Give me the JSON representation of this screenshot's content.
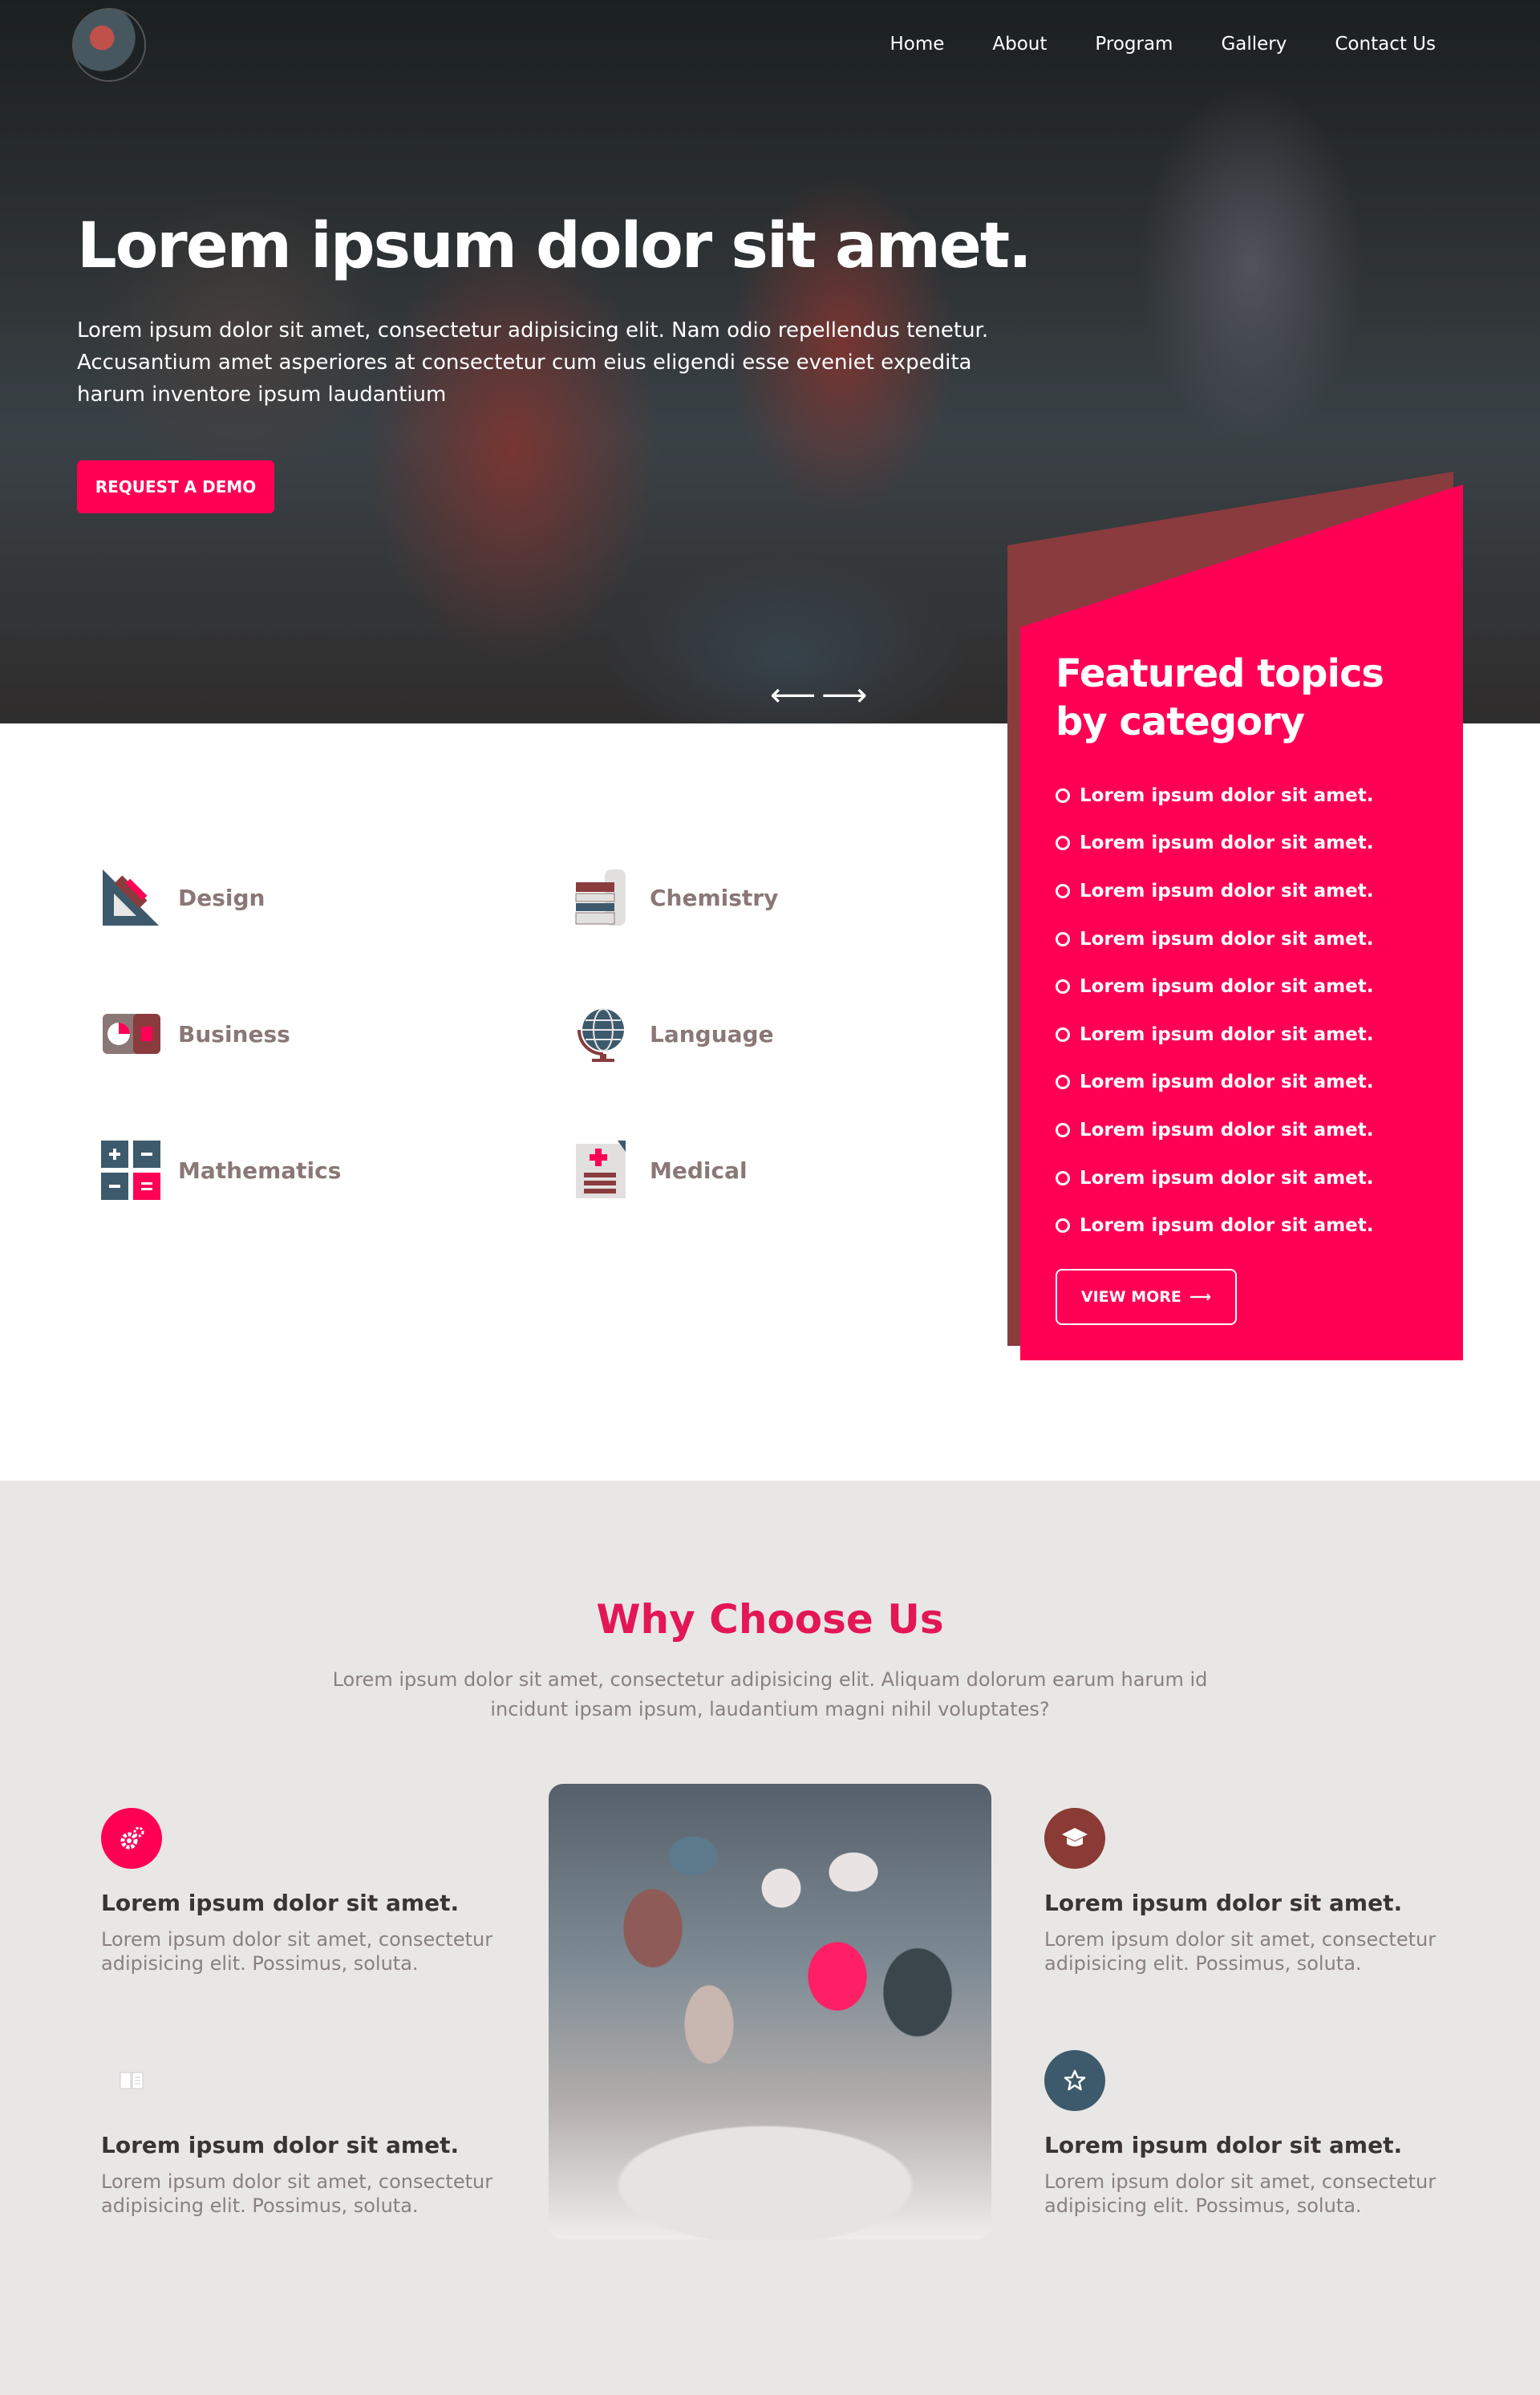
{
  "nav": {
    "items": [
      "Home",
      "About",
      "Program",
      "Gallery",
      "Contact Us"
    ]
  },
  "hero": {
    "title": "Lorem ipsum dolor sit amet.",
    "description": "Lorem ipsum dolor sit amet, consectetur adipisicing elit. Nam odio repellendus tenetur. Accusantium amet asperiores at consectetur cum eius eligendi esse eveniet expedita harum inventore ipsum laudantium",
    "cta_label": "REQUEST A DEMO",
    "prev_arrow": "⟵",
    "next_arrow": "⟶"
  },
  "featured": {
    "title": "Featured topics by category",
    "items": [
      "Lorem ipsum dolor sit amet.",
      "Lorem ipsum dolor sit amet.",
      "Lorem ipsum dolor sit amet.",
      "Lorem ipsum dolor sit amet.",
      "Lorem ipsum dolor sit amet.",
      "Lorem ipsum dolor sit amet.",
      "Lorem ipsum dolor sit amet.",
      "Lorem ipsum dolor sit amet.",
      "Lorem ipsum dolor sit amet.",
      "Lorem ipsum dolor sit amet."
    ],
    "button_label": "VIEW MORE",
    "button_arrow": "⟶"
  },
  "categories": [
    {
      "label": "Design",
      "icon": "design-icon"
    },
    {
      "label": "Chemistry",
      "icon": "chemistry-icon"
    },
    {
      "label": "Business",
      "icon": "business-icon"
    },
    {
      "label": "Language",
      "icon": "globe-icon"
    },
    {
      "label": "Mathematics",
      "icon": "mathematics-icon"
    },
    {
      "label": "Medical",
      "icon": "medical-icon"
    }
  ],
  "why": {
    "title": "Why Choose Us",
    "subtitle": "Lorem ipsum dolor sit amet, consectetur adipisicing elit. Aliquam dolorum earum harum id incidunt ipsam ipsum, laudantium magni nihil voluptates?",
    "features": [
      {
        "title": "Lorem ipsum dolor sit amet.",
        "text": "Lorem ipsum dolor sit amet, consectetur adipisicing elit. Possimus, soluta.",
        "icon": "gears-icon",
        "color": "#ff0055"
      },
      {
        "title": "Lorem ipsum dolor sit amet.",
        "text": "Lorem ipsum dolor sit amet, consectetur adipisicing elit. Possimus, soluta.",
        "icon": "graduation-cap-icon",
        "color": "#8a3b35"
      },
      {
        "title": "Lorem ipsum dolor sit amet.",
        "text": "Lorem ipsum dolor sit amet, consectetur adipisicing elit. Possimus, soluta.",
        "icon": "book-icon",
        "color": "#e8e7e6"
      },
      {
        "title": "Lorem ipsum dolor sit amet.",
        "text": "Lorem ipsum dolor sit amet, consectetur adipisicing elit. Possimus, soluta.",
        "icon": "star-icon",
        "color": "#3d5a6c"
      }
    ]
  },
  "colors": {
    "accent": "#ff0055",
    "accent_dark": "#8a3b3e",
    "title_red": "#e31755",
    "section_bg": "#e8e7e6"
  }
}
